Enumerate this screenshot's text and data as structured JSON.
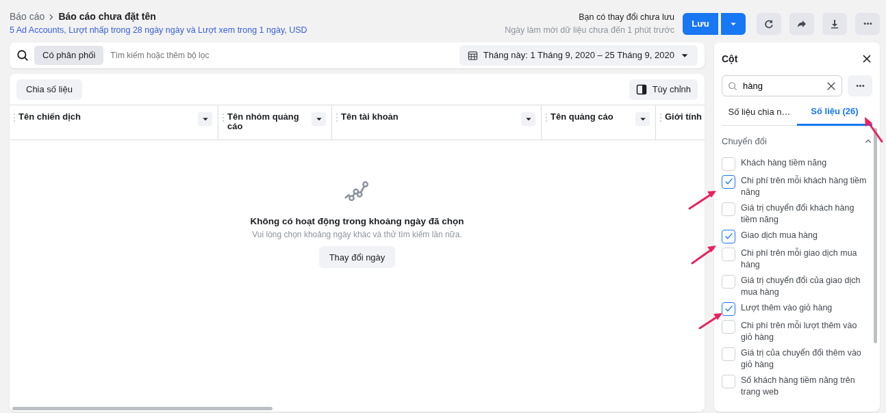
{
  "header": {
    "breadcrumb": [
      {
        "label": "Báo cáo"
      },
      {
        "label": "Báo cáo chưa đặt tên"
      }
    ],
    "subtitle": "5 Ad Accounts, Lượt nhấp trong 28 ngày ngày và Lượt xem trong 1 ngày, USD",
    "unsaved_notice": "Bạn có thay đổi chưa lưu",
    "refresh_notice": "Ngày làm mới dữ liệu chưa đến 1 phút trước",
    "save_button": "Lưu"
  },
  "filter_bar": {
    "chip": "Có phân phối",
    "placeholder": "Tìm kiếm hoặc thêm bộ lọc",
    "date_range": "Tháng này: 1 Tháng 9, 2020 – 25 Tháng 9, 2020"
  },
  "table": {
    "breakdown_button": "Chia số liệu",
    "customize_button": "Tùy chỉnh",
    "columns": [
      {
        "label": "Tên chiến dịch",
        "has_menu": true
      },
      {
        "label": "Tên nhóm quảng cáo",
        "has_menu": true
      },
      {
        "label": "Tên tài khoản",
        "has_menu": true
      },
      {
        "label": "Tên quảng cáo",
        "has_menu": true
      },
      {
        "label": "Giới tính",
        "has_menu": false
      }
    ],
    "empty_state": {
      "title": "Không có hoạt động trong khoảng ngày đã chọn",
      "message": "Vui lòng chọn khoảng ngày khác và thử tìm kiếm lần nữa.",
      "button": "Thay đổi ngày"
    }
  },
  "columns_panel": {
    "title": "Cột",
    "search_value": "hàng",
    "tabs": [
      {
        "label": "Số liệu chia n…",
        "selected": false
      },
      {
        "label": "Số liệu (26)",
        "selected": true
      }
    ],
    "section": {
      "title": "Chuyển đổi",
      "expanded": true,
      "items": [
        {
          "label": "Khách hàng tiềm năng",
          "checked": false
        },
        {
          "label": "Chi phí trên mỗi khách hàng tiềm năng",
          "checked": true
        },
        {
          "label": "Giá trị chuyển đổi khách hàng tiềm năng",
          "checked": false
        },
        {
          "label": "Giao dịch mua hàng",
          "checked": true
        },
        {
          "label": "Chi phí trên mỗi giao dịch mua hàng",
          "checked": false
        },
        {
          "label": "Giá trị chuyển đổi của giao dịch mua hàng",
          "checked": false
        },
        {
          "label": "Lượt thêm vào giỏ hàng",
          "checked": true
        },
        {
          "label": "Chi phí trên mỗi lượt thêm vào giỏ hàng",
          "checked": false
        },
        {
          "label": "Giá trị của chuyển đổi thêm vào giỏ hàng",
          "checked": false
        },
        {
          "label": "Số khách hàng tiềm năng trên trang web",
          "checked": false
        }
      ]
    }
  }
}
